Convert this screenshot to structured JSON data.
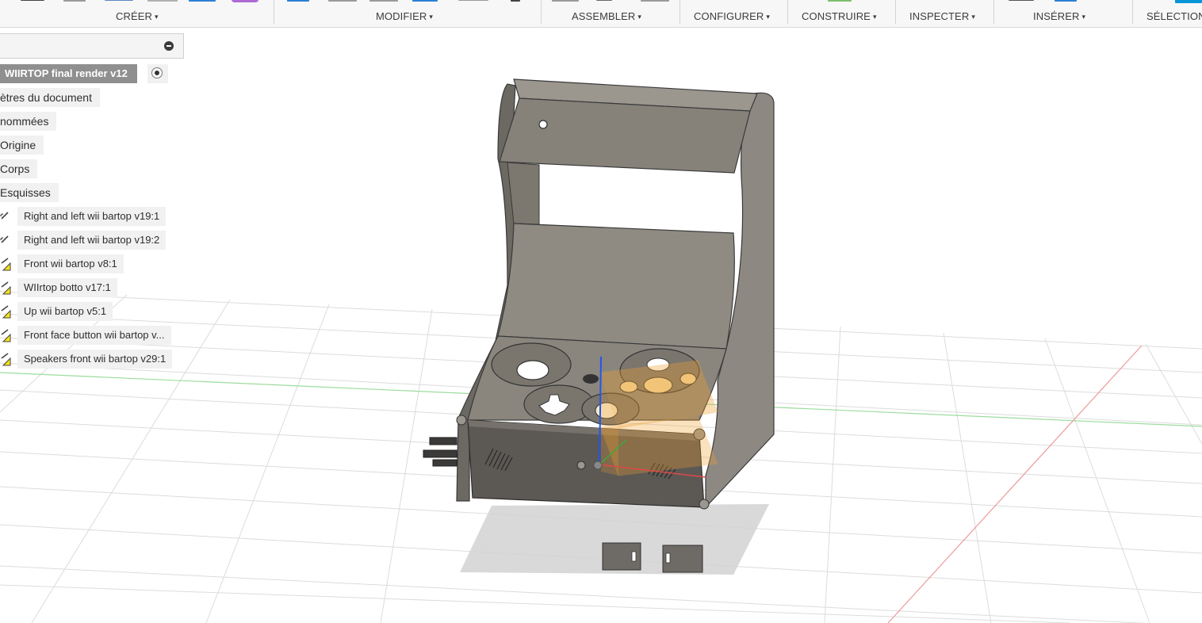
{
  "toolbar": {
    "groups": [
      {
        "label": "CRÉER"
      },
      {
        "label": "MODIFIER"
      },
      {
        "label": "ASSEMBLER"
      },
      {
        "label": "CONFIGURER"
      },
      {
        "label": "CONSTRUIRE"
      },
      {
        "label": "INSPECTER"
      },
      {
        "label": "INSÉRER"
      },
      {
        "label": "SÉLECTION"
      }
    ],
    "caret": "▾"
  },
  "browser": {
    "root": "WIIRTOP final render v12",
    "folders": [
      "ètres du document",
      "nommées",
      "Origine",
      "Corps",
      "Esquisses"
    ],
    "sketches": [
      {
        "label": "Right and left wii bartop v19:1",
        "icon": "sketch-link-icon"
      },
      {
        "label": "Right and left wii bartop v19:2",
        "icon": "sketch-link-icon"
      },
      {
        "label": "Front wii bartop v8:1",
        "icon": "sketch-warning-icon"
      },
      {
        "label": "WIIrtop botto v17:1",
        "icon": "sketch-warning-icon"
      },
      {
        "label": "Up wii bartop v5:1",
        "icon": "sketch-warning-icon"
      },
      {
        "label": "Front face button wii bartop v...",
        "icon": "sketch-warning-icon"
      },
      {
        "label": "Speakers front wii bartop v29:1",
        "icon": "sketch-warning-icon"
      }
    ]
  },
  "colors": {
    "accent": "#0696d7",
    "grid": "#d8d8d8",
    "axis_x": "#e07070",
    "axis_y": "#7ccf7c",
    "model": "#8f8a82",
    "highlight": "#f0a030"
  }
}
